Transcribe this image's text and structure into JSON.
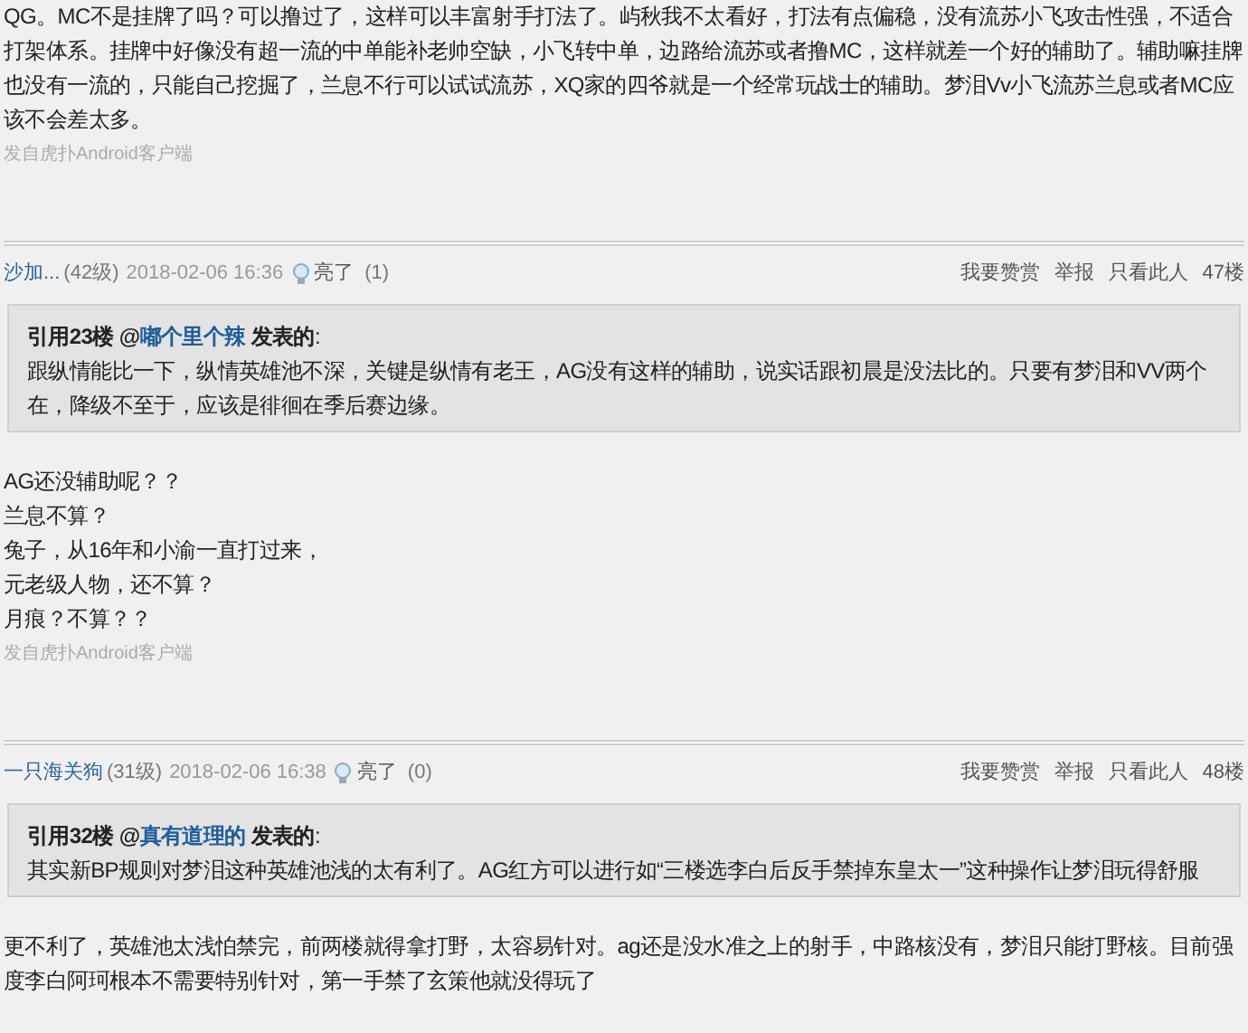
{
  "posts": [
    {
      "body": [
        "QG。MC不是挂牌了吗？可以撸过了，这样可以丰富射手打法了。屿秋我不太看好，打法有点偏稳，没有流苏小飞攻击性强，不适合打架体系。挂牌中好像没有超一流的中单能补老帅空缺，小飞转中单，边路给流苏或者撸MC，这样就差一个好的辅助了。辅助嘛挂牌也没有一流的，只能自己挖掘了，兰息不行可以试试流苏，XQ家的四爷就是一个经常玩战士的辅助。梦泪Vv小飞流苏兰息或者MC应该不会差太多。"
      ],
      "source": "发自虎扑Android客户端"
    },
    {
      "author": "沙加...",
      "level": "(42级)",
      "time": "2018-02-06 16:36",
      "light": "亮了",
      "light_count": "(1)",
      "actions": [
        "我要赞赏",
        "举报",
        "只看此人"
      ],
      "floor": "47楼",
      "quote": {
        "prefix": "引用23楼 @",
        "user": "嘟个里个辣",
        "suffix": " 发表的",
        "colon": ":",
        "text": "跟纵情能比一下，纵情英雄池不深，关键是纵情有老王，AG没有这样的辅助，说实话跟初晨是没法比的。只要有梦泪和VV两个在，降级不至于，应该是徘徊在季后赛边缘。"
      },
      "body": [
        "AG还没辅助呢？？",
        "兰息不算？",
        "兔子，从16年和小渝一直打过来，",
        "元老级人物，还不算？",
        "月痕？不算？？"
      ],
      "source": "发自虎扑Android客户端"
    },
    {
      "author": "一只海关狗",
      "level": "(31级)",
      "time": "2018-02-06 16:38",
      "light": "亮了",
      "light_count": "(0)",
      "actions": [
        "我要赞赏",
        "举报",
        "只看此人"
      ],
      "floor": "48楼",
      "quote": {
        "prefix": "引用32楼 @",
        "user": "真有道理的",
        "suffix": " 发表的",
        "colon": ":",
        "text": "其实新BP规则对梦泪这种英雄池浅的太有利了。AG红方可以进行如“三楼选李白后反手禁掉东皇太一”这种操作让梦泪玩得舒服"
      },
      "body": [
        "更不利了，英雄池太浅怕禁完，前两楼就得拿打野，太容易针对。ag还是没水准之上的射手，中路核没有，梦泪只能打野核。目前强度李白阿珂根本不需要特别针对，第一手禁了玄策他就没得玩了"
      ]
    }
  ]
}
